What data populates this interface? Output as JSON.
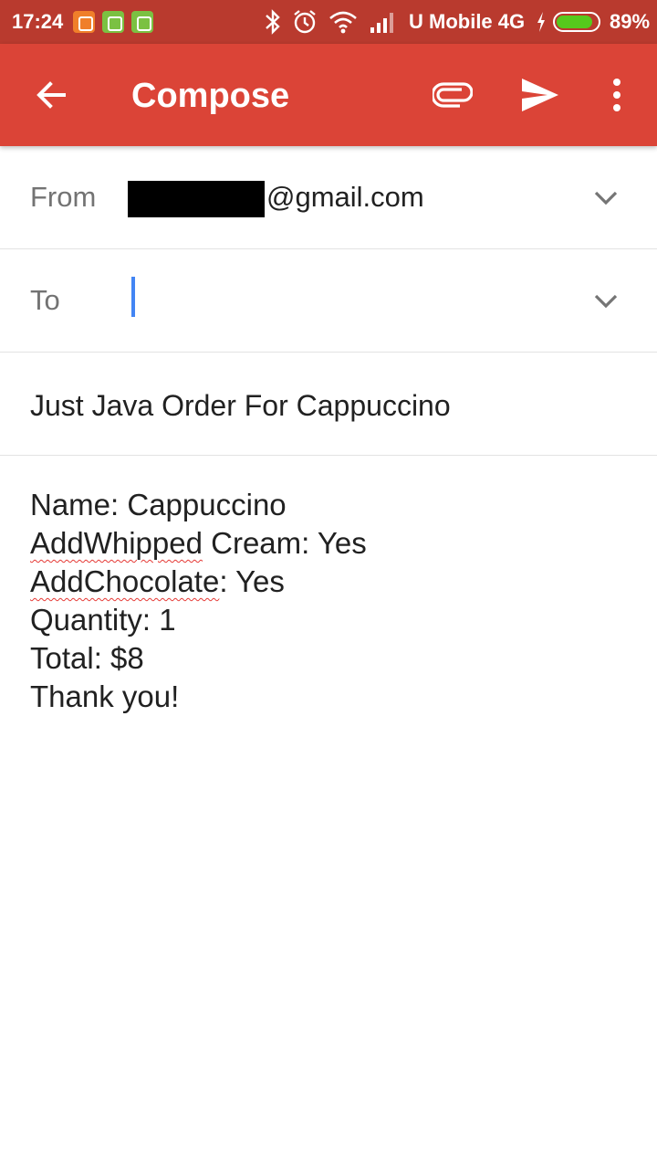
{
  "status_bar": {
    "time": "17:24",
    "carrier": "U Mobile 4G",
    "battery_percent": "89%",
    "battery_level": 0.89,
    "icons": [
      "app-notification-icon",
      "battery-saver-icon",
      "android-icon",
      "bluetooth-icon",
      "alarm-icon",
      "wifi-icon",
      "signal-icon",
      "charging-icon"
    ],
    "color": "#b93a2e"
  },
  "app_bar": {
    "title": "Compose",
    "color": "#db4437",
    "actions": [
      "back-arrow-icon",
      "attach-icon",
      "send-icon",
      "more-vert-icon"
    ]
  },
  "compose": {
    "from_label": "From",
    "from_value": "@gmail.com",
    "to_label": "To",
    "to_value": "",
    "subject": "Just Java Order For Cappuccino",
    "body": {
      "line1": "Name: Cappuccino",
      "line2_a": "AddWhipped",
      "line2_b": " Cream: Yes",
      "line3_a": "AddChocolate",
      "line3_b": ": Yes",
      "line4": "Quantity: 1",
      "line5": "Total: $8",
      "line6": "Thank you!"
    }
  }
}
